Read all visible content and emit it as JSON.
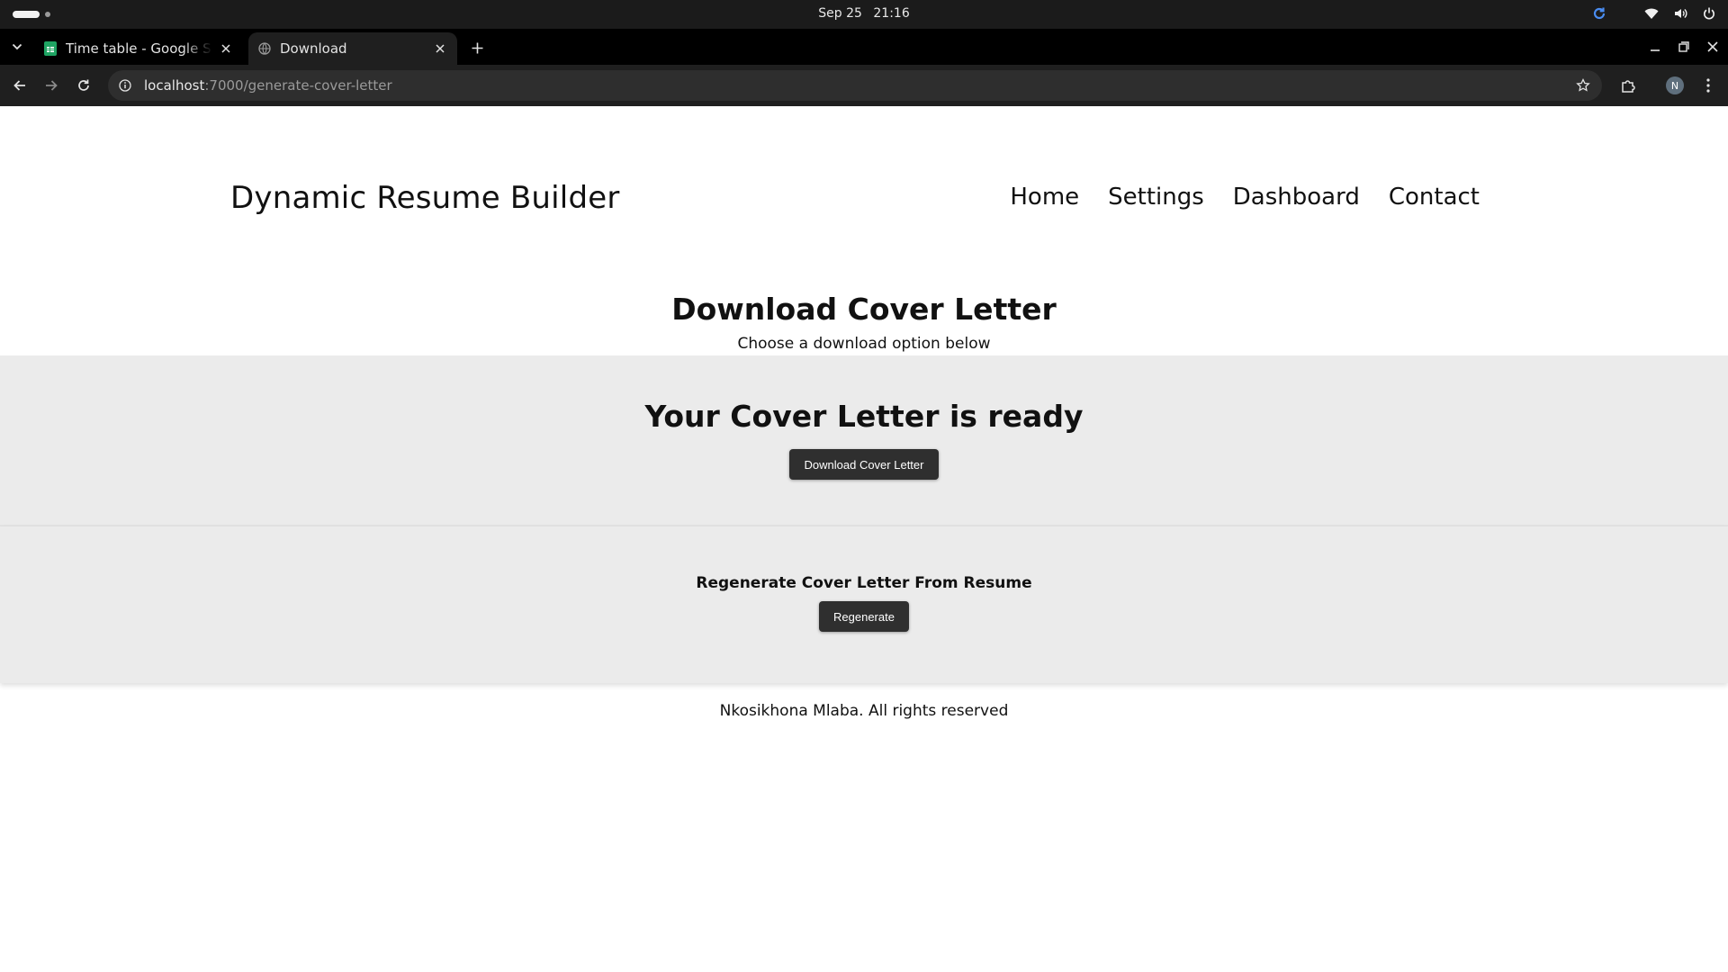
{
  "os": {
    "date": "Sep 25",
    "time": "21:16"
  },
  "browser": {
    "tabs": [
      {
        "title": "Time table - Google Sheets",
        "favicon": "google-sheets-icon",
        "active": false
      },
      {
        "title": "Download",
        "favicon": "globe-icon",
        "active": true
      }
    ],
    "url_host": "localhost",
    "url_path": ":7000/generate-cover-letter",
    "profile_initial": "N"
  },
  "site": {
    "brand": "Dynamic Resume Builder",
    "nav": [
      {
        "label": "Home"
      },
      {
        "label": "Settings"
      },
      {
        "label": "Dashboard"
      },
      {
        "label": "Contact"
      }
    ]
  },
  "main": {
    "heading": "Download Cover Letter",
    "subheading": "Choose a download option below",
    "ready_title": "Your Cover Letter is ready",
    "download_button": "Download Cover Letter",
    "regenerate_title": "Regenerate Cover Letter From Resume",
    "regenerate_button": "Regenerate"
  },
  "footer": {
    "text": "Nkosikhona Mlaba. All rights reserved"
  },
  "colors": {
    "panel_bg": "#ebebeb",
    "button_bg": "#2f2f2f",
    "browser_dark": "#1f1f1f"
  }
}
